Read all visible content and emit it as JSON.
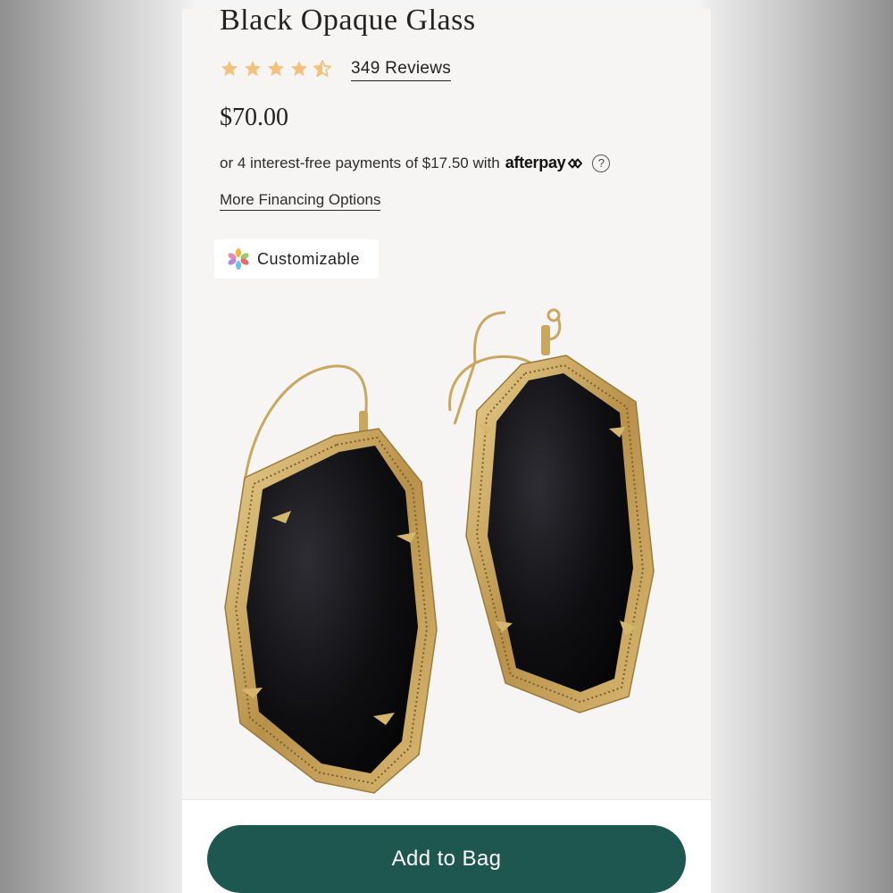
{
  "product": {
    "title": "Black Opaque Glass",
    "rating": 4.5,
    "rating_max": 5,
    "reviews_label": "349 Reviews",
    "price": "$70.00"
  },
  "payment": {
    "installment_text": "or 4 interest-free payments of $17.50 with",
    "provider": "afterpay",
    "provider_icon": "afterpay-arrows-icon",
    "help_glyph": "?",
    "financing_link": "More Financing Options"
  },
  "badge": {
    "label": "Customizable",
    "icon": "color-petals-icon"
  },
  "cta": {
    "label": "Add to Bag"
  },
  "colors": {
    "star": "#f3c07e",
    "cta_background": "#1e5650",
    "panel_background": "#f6f5f4"
  }
}
